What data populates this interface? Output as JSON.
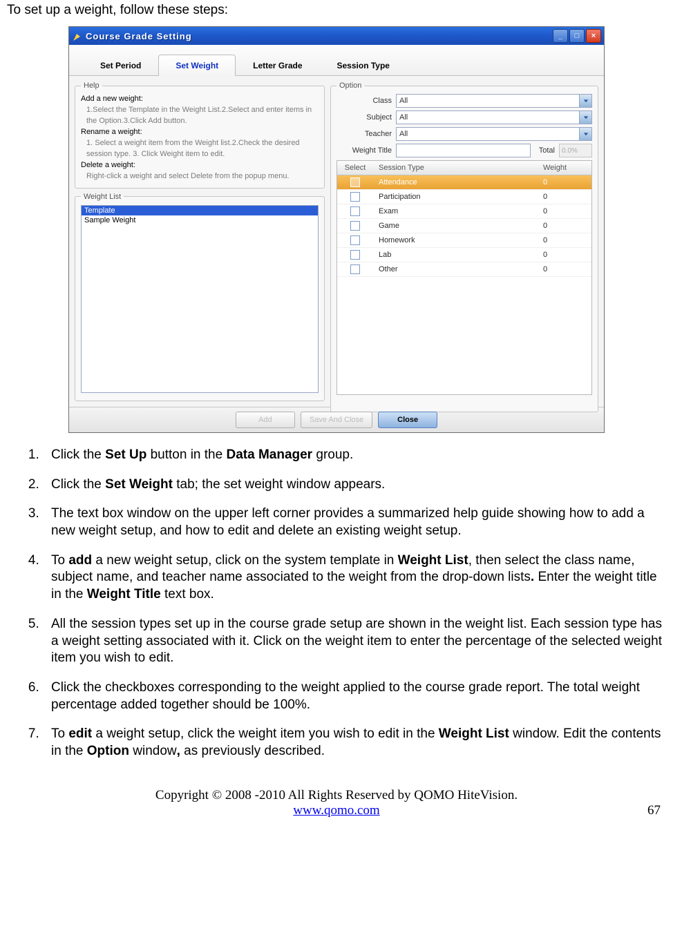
{
  "intro": "To set up a weight, follow these steps:",
  "window": {
    "title": "Course Grade Setting",
    "tabs": [
      "Set Period",
      "Set Weight",
      "Letter Grade",
      "Session Type"
    ],
    "activeTab": 1,
    "help": {
      "legend": "Help",
      "sections": [
        {
          "title": "Add a new weight:",
          "body": "1.Select the Template in the Weight List.2.Select and enter items in the Option.3.Click Add button."
        },
        {
          "title": "Rename a weight:",
          "body": "1. Select a weight item from the Weight list.2.Check the desired session type. 3. Click Weight item to edit."
        },
        {
          "title": "Delete a weight:",
          "body": "Right-click a weight and select Delete from the popup menu."
        }
      ]
    },
    "weightList": {
      "legend": "Weight List",
      "items": [
        "Template",
        "Sample Weight"
      ],
      "selectedIndex": 0
    },
    "option": {
      "legend": "Option",
      "classLabel": "Class",
      "classValue": "All",
      "subjectLabel": "Subject",
      "subjectValue": "All",
      "teacherLabel": "Teacher",
      "teacherValue": "All",
      "weightTitleLabel": "Weight Title",
      "weightTitleValue": "",
      "totalLabel": "Total",
      "totalValue": "0.0%",
      "grid": {
        "headers": {
          "select": "Select",
          "type": "Session Type",
          "weight": "Weight"
        },
        "rows": [
          {
            "type": "Attendance",
            "weight": "0",
            "selected": true
          },
          {
            "type": "Participation",
            "weight": "0",
            "selected": false
          },
          {
            "type": "Exam",
            "weight": "0",
            "selected": false
          },
          {
            "type": "Game",
            "weight": "0",
            "selected": false
          },
          {
            "type": "Homework",
            "weight": "0",
            "selected": false
          },
          {
            "type": "Lab",
            "weight": "0",
            "selected": false
          },
          {
            "type": "Other",
            "weight": "0",
            "selected": false
          }
        ]
      }
    },
    "buttons": {
      "add": "Add",
      "save": "Save And Close",
      "close": "Close"
    }
  },
  "steps": [
    {
      "pre": "Click the ",
      "b1": "Set Up",
      "mid1": " button in the ",
      "b2": "Data Manager",
      "post": " group."
    },
    {
      "pre": "Click the ",
      "b1": "Set Weight",
      "post": " tab; the set weight window appears."
    },
    {
      "plain": "The text box window on the upper left corner provides a summarized help guide showing how to add a new weight setup, and how to edit and delete an existing weight setup."
    },
    {
      "pre": "To ",
      "b1": "add",
      "mid1": " a new weight setup, click on the system template in ",
      "b2": "Weight List",
      "mid2": ", then select the class name, subject name, and teacher name associated to the weight from the drop-down lists",
      "b3": ".",
      "mid3": " Enter the weight title in the ",
      "b4": "Weight Title",
      "post": " text box."
    },
    {
      "plain": "All the session types set up in the course grade setup are shown in the weight list. Each session type has a weight setting associated with it. Click on the weight item to enter the percentage of the selected weight item you wish to edit."
    },
    {
      "plain": "Click the checkboxes corresponding to the weight applied to the course grade report. The total weight percentage added together should be 100%."
    },
    {
      "pre": "To ",
      "b1": "edit",
      "mid1": " a weight setup, click the weight item you wish to edit in the ",
      "b2": "Weight List",
      "mid2": " window. Edit the contents in the ",
      "b3": "Option",
      "mid3": " window",
      "b4": ",",
      "post": " as previously described."
    }
  ],
  "footer": {
    "copyright": "Copyright © 2008 -2010 All Rights Reserved by QOMO HiteVision.",
    "url": "www.qomo.com",
    "page": "67"
  }
}
